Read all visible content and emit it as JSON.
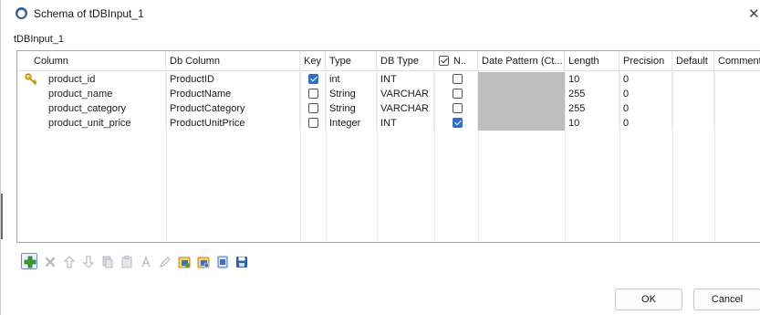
{
  "window": {
    "title": "Schema of tDBInput_1",
    "close_glyph": "✕"
  },
  "component_label": "tDBInput_1",
  "table": {
    "headers": [
      "Column",
      "Db Column",
      "Key",
      "Type",
      "DB Type",
      "N..",
      "Date Pattern (Ct...",
      "Length",
      "Precision",
      "Default",
      "Comment"
    ],
    "rows": [
      {
        "column": "product_id",
        "db_column": "ProductID",
        "key": true,
        "type": "int",
        "db_type": "INT",
        "nullable": false,
        "date_pattern": "",
        "length": "10",
        "precision": "0",
        "default": "",
        "comment": "",
        "primary_key_icon": "key-icon"
      },
      {
        "column": "product_name",
        "db_column": "ProductName",
        "key": false,
        "type": "String",
        "db_type": "VARCHAR",
        "nullable": false,
        "date_pattern": "",
        "length": "255",
        "precision": "0",
        "default": "",
        "comment": ""
      },
      {
        "column": "product_category",
        "db_column": "ProductCategory",
        "key": false,
        "type": "String",
        "db_type": "VARCHAR",
        "nullable": false,
        "date_pattern": "",
        "length": "255",
        "precision": "0",
        "default": "",
        "comment": ""
      },
      {
        "column": "product_unit_price",
        "db_column": "ProductUnitPrice",
        "key": false,
        "type": "Integer",
        "db_type": "INT",
        "nullable": true,
        "date_pattern": "",
        "length": "10",
        "precision": "0",
        "default": "",
        "comment": ""
      }
    ]
  },
  "toolbar": {
    "buttons": [
      {
        "name": "add-icon",
        "enabled": true
      },
      {
        "name": "remove-icon",
        "enabled": false
      },
      {
        "name": "move-up-icon",
        "enabled": false
      },
      {
        "name": "move-down-icon",
        "enabled": false
      },
      {
        "name": "copy-icon",
        "enabled": false
      },
      {
        "name": "paste-icon",
        "enabled": false
      },
      {
        "name": "uppercase-icon",
        "enabled": false
      },
      {
        "name": "edit-icon",
        "enabled": false
      },
      {
        "name": "import-schema-icon",
        "enabled": true
      },
      {
        "name": "export-schema-icon",
        "enabled": true
      },
      {
        "name": "guess-schema-icon",
        "enabled": true
      },
      {
        "name": "save-icon",
        "enabled": true
      }
    ]
  },
  "buttons": {
    "ok": "OK",
    "cancel": "Cancel"
  },
  "colors": {
    "checkbox_checked": "#2f6ec3",
    "date_pattern_disabled": "#bdbdbd",
    "icon_blue": "#2f5fb3"
  }
}
